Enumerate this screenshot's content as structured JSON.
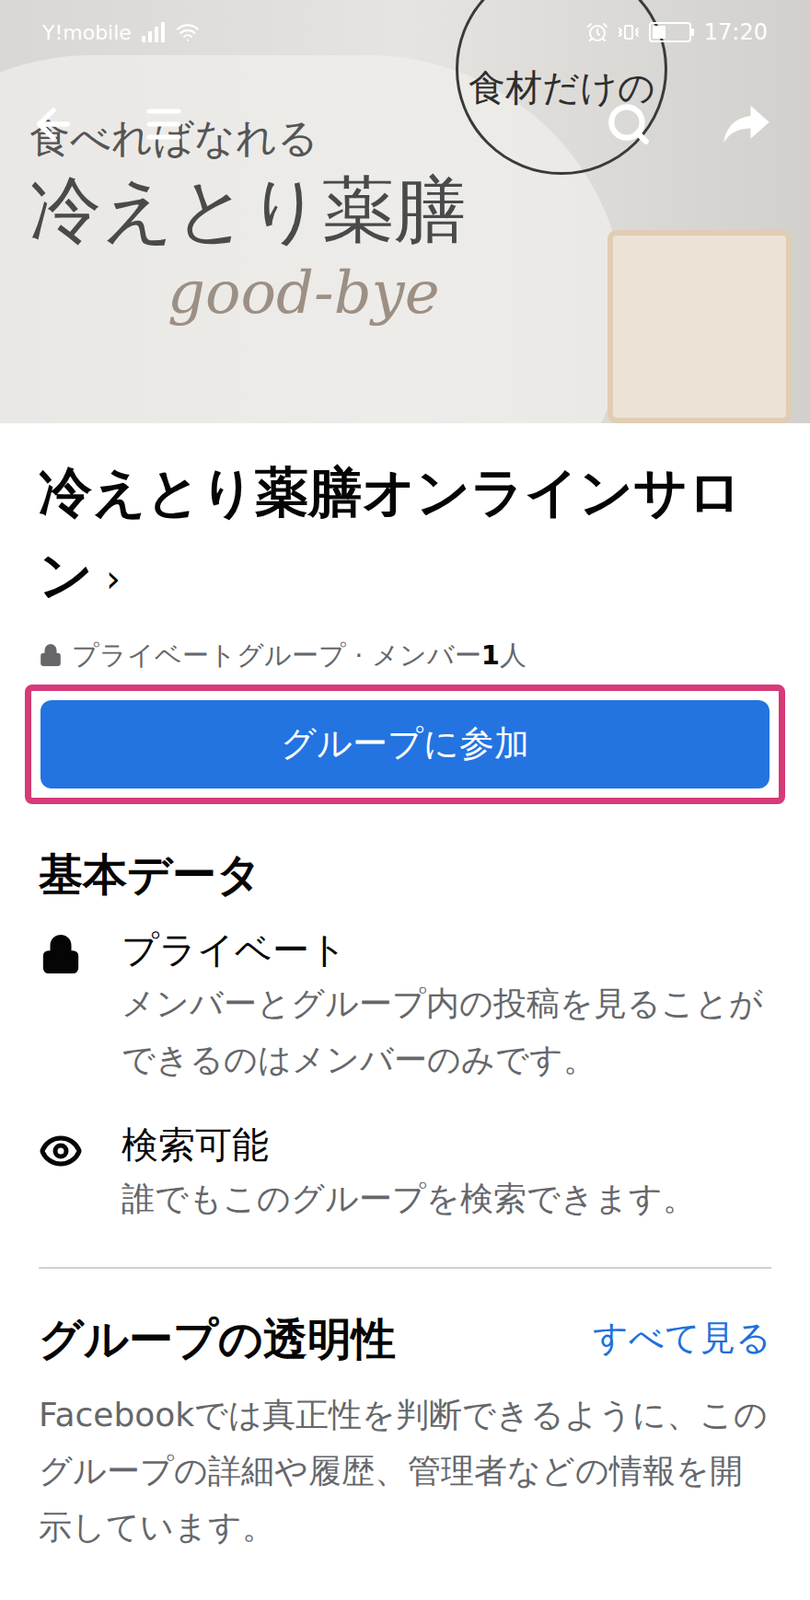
{
  "status_bar": {
    "carrier": "Y!mobile",
    "time": "17:20"
  },
  "cover": {
    "bubble": "食材だけの",
    "tagline": "食べればなれる",
    "headline": "冷えとり薬膳",
    "script": "good-bye"
  },
  "group": {
    "name": "冷えとり薬膳オンラインサロン",
    "chevron": "›",
    "privacy": "プライベートグループ",
    "separator": "·",
    "members_label": "メンバー",
    "members_count": "1",
    "members_unit": "人"
  },
  "join_button": {
    "label": "グループに参加",
    "highlighted": true
  },
  "about": {
    "title": "基本データ",
    "items": [
      {
        "kind": "private",
        "title": "プライベート",
        "description": "メンバーとグループ内の投稿を見ることができるのはメンバーのみです。"
      },
      {
        "kind": "visible",
        "title": "検索可能",
        "description": "誰でもこのグループを検索できます。"
      }
    ]
  },
  "transparency": {
    "title": "グループの透明性",
    "link": "すべて見る",
    "text": "Facebookでは真正性を判断できるように、このグループの詳細や履歴、管理者などの情報を開示しています。"
  }
}
